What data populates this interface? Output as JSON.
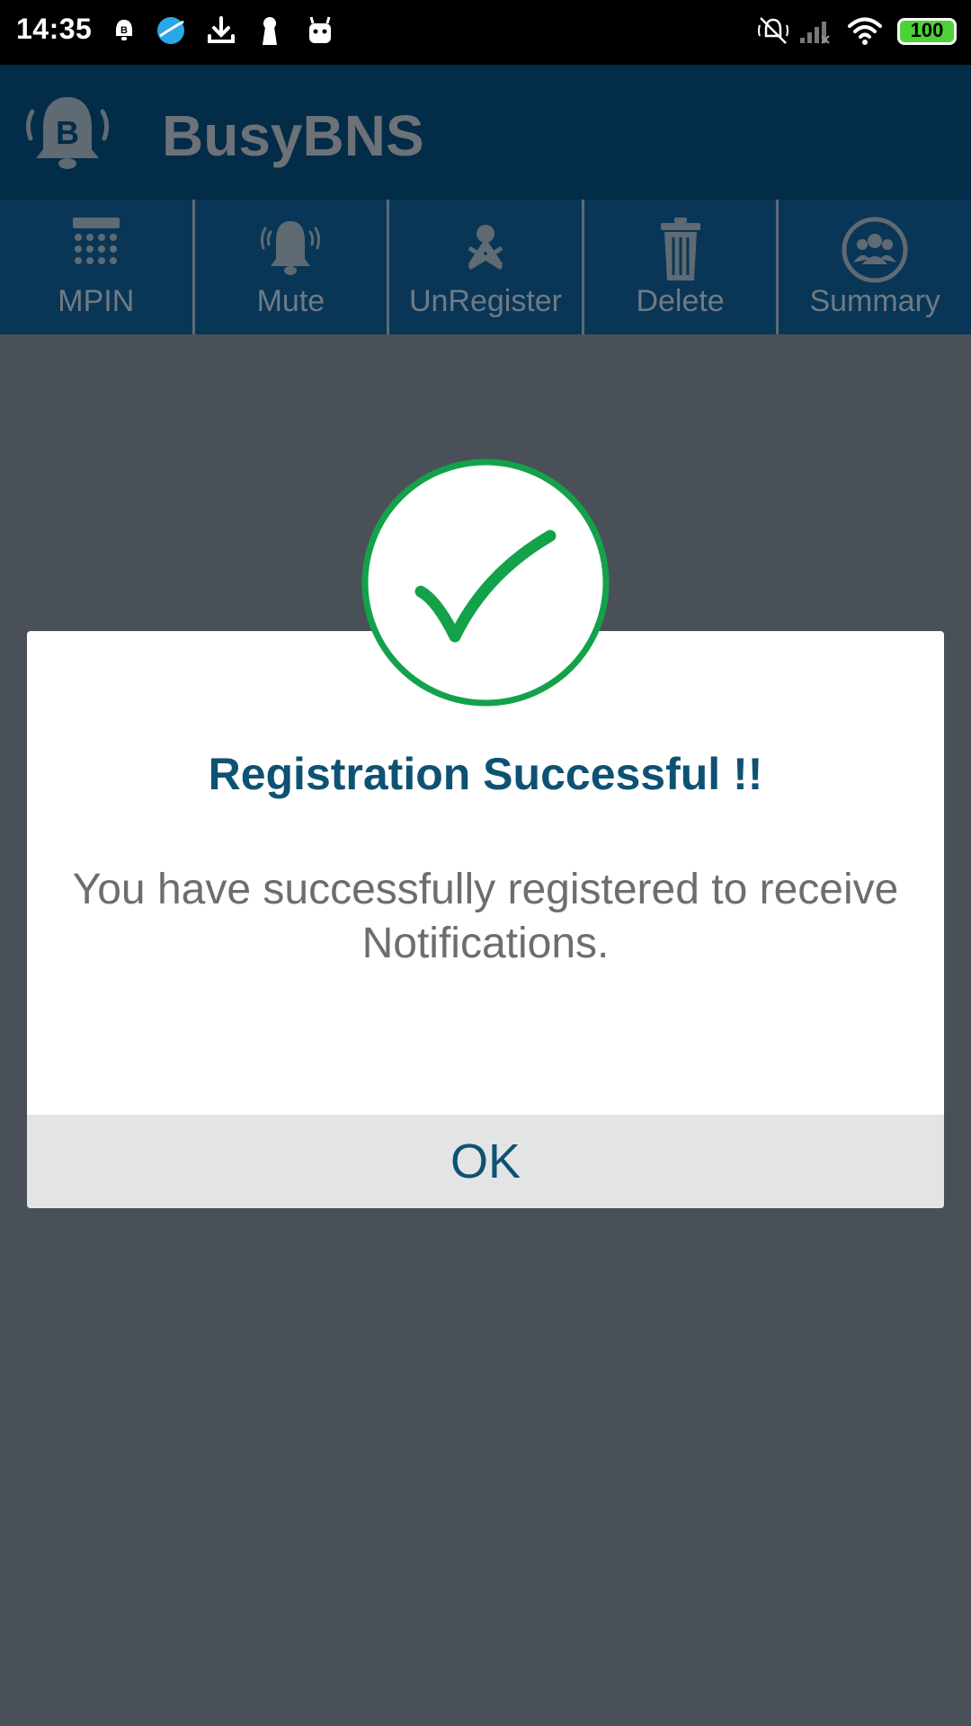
{
  "status_bar": {
    "time": "14:35",
    "battery": "100",
    "icons": [
      "notification-bell-icon",
      "browser-icon",
      "download-icon",
      "keyhole-icon",
      "android-icon",
      "mute-icon",
      "signal-icon",
      "wifi-icon",
      "battery-icon"
    ]
  },
  "app": {
    "title": "BusyBNS",
    "logo_icon": "busybns-bell-logo-icon"
  },
  "toolbar": {
    "items": [
      {
        "label": "MPIN",
        "icon": "keypad-icon"
      },
      {
        "label": "Mute",
        "icon": "bell-icon"
      },
      {
        "label": "UnRegister",
        "icon": "unregister-person-icon"
      },
      {
        "label": "Delete",
        "icon": "trash-icon"
      },
      {
        "label": "Summary",
        "icon": "group-icon"
      }
    ]
  },
  "dialog": {
    "icon": "check-circle-icon",
    "title": "Registration Successful !!",
    "message": "You have successfully registered to receive Notifications.",
    "ok_label": "OK"
  },
  "colors": {
    "overlay": "#4a5058",
    "app_bar": "#022c47",
    "toolbar": "#093656",
    "accent_text": "#0e5273",
    "success_green": "#13a24a",
    "button_bg": "#e3e4e5"
  }
}
